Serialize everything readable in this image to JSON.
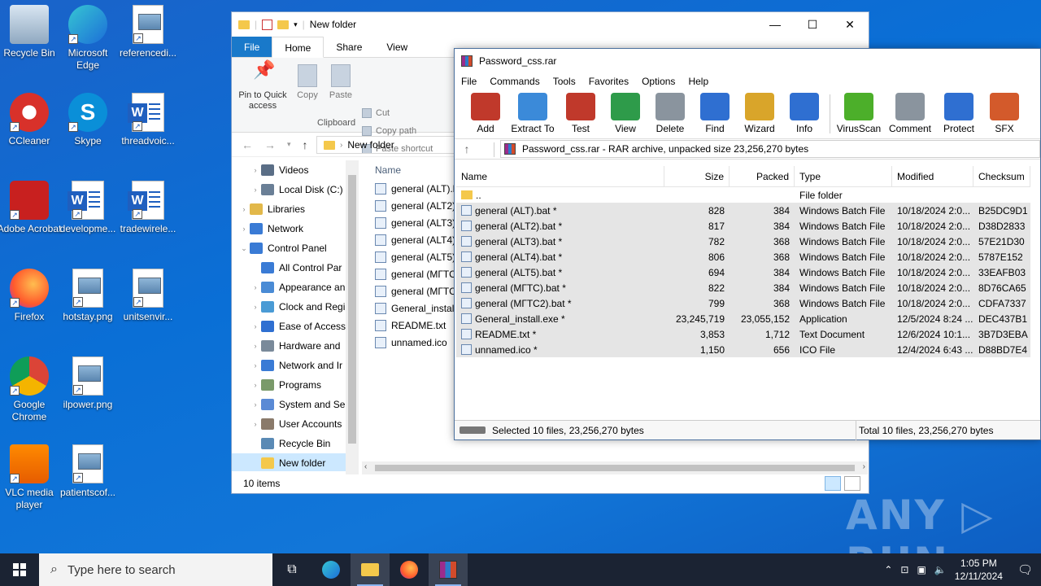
{
  "desktop": {
    "icons": [
      {
        "label": "Recycle Bin"
      },
      {
        "label": "Microsoft Edge"
      },
      {
        "label": "referencedi..."
      },
      {
        "label": "CCleaner"
      },
      {
        "label": "Skype"
      },
      {
        "label": "threadvoic..."
      },
      {
        "label": "Adobe Acrobat"
      },
      {
        "label": "developme..."
      },
      {
        "label": "tradewirele..."
      },
      {
        "label": "Firefox"
      },
      {
        "label": "hotstay.png"
      },
      {
        "label": "unitsenvir..."
      },
      {
        "label": "Google Chrome"
      },
      {
        "label": "ilpower.png"
      },
      {
        "label": "VLC media player"
      },
      {
        "label": "patientscof..."
      }
    ]
  },
  "explorer": {
    "title": "New folder",
    "tabs": {
      "file": "File",
      "home": "Home",
      "share": "Share",
      "view": "View"
    },
    "ribbon": {
      "pin": "Pin to Quick access",
      "copy": "Copy",
      "paste": "Paste",
      "cut": "Cut",
      "copy_path": "Copy path",
      "paste_shortcut": "Paste shortcut",
      "group": "Clipboard"
    },
    "address": "New folder",
    "nav": [
      {
        "label": "Videos"
      },
      {
        "label": "Local Disk (C:)"
      },
      {
        "label": "Libraries"
      },
      {
        "label": "Network"
      },
      {
        "label": "Control Panel"
      },
      {
        "label": "All Control Par"
      },
      {
        "label": "Appearance an"
      },
      {
        "label": "Clock and Regi"
      },
      {
        "label": "Ease of Access"
      },
      {
        "label": "Hardware and"
      },
      {
        "label": "Network and Ir"
      },
      {
        "label": "Programs"
      },
      {
        "label": "System and Se"
      },
      {
        "label": "User Accounts"
      },
      {
        "label": "Recycle Bin"
      },
      {
        "label": "New folder"
      }
    ],
    "column_name": "Name",
    "files": [
      {
        "label": "general (ALT).b"
      },
      {
        "label": "general (ALT2)"
      },
      {
        "label": "general (ALT3)"
      },
      {
        "label": "general (ALT4)"
      },
      {
        "label": "general (ALT5)"
      },
      {
        "label": "general (МГТС"
      },
      {
        "label": "general (МГТС"
      },
      {
        "label": "General_install"
      },
      {
        "label": "README.txt"
      },
      {
        "label": "unnamed.ico"
      }
    ],
    "status": "10 items"
  },
  "winrar": {
    "title": "Password_css.rar",
    "menu": [
      "File",
      "Commands",
      "Tools",
      "Favorites",
      "Options",
      "Help"
    ],
    "toolbar": [
      {
        "label": "Add",
        "color": "#c0392b"
      },
      {
        "label": "Extract To",
        "color": "#3b8ad9"
      },
      {
        "label": "Test",
        "color": "#c0392b"
      },
      {
        "label": "View",
        "color": "#2e9b4a"
      },
      {
        "label": "Delete",
        "color": "#8a949e"
      },
      {
        "label": "Find",
        "color": "#2f6fd1"
      },
      {
        "label": "Wizard",
        "color": "#d9a52a"
      },
      {
        "label": "Info",
        "color": "#2f6fd1"
      },
      {
        "label": "VirusScan",
        "color": "#4caf2a"
      },
      {
        "label": "Comment",
        "color": "#8a949e"
      },
      {
        "label": "Protect",
        "color": "#2f6fd1"
      },
      {
        "label": "SFX",
        "color": "#d35a2b"
      }
    ],
    "path": "Password_css.rar - RAR archive, unpacked size 23,256,270 bytes",
    "columns": {
      "name": "Name",
      "size": "Size",
      "packed": "Packed",
      "type": "Type",
      "modified": "Modified",
      "checksum": "Checksum"
    },
    "rows": [
      {
        "name": "..",
        "size": "",
        "packed": "",
        "type": "File folder",
        "modified": "",
        "checksum": ""
      },
      {
        "name": "general (ALT).bat *",
        "size": "828",
        "packed": "384",
        "type": "Windows Batch File",
        "modified": "10/18/2024 2:0...",
        "checksum": "B25DC9D1"
      },
      {
        "name": "general (ALT2).bat *",
        "size": "817",
        "packed": "384",
        "type": "Windows Batch File",
        "modified": "10/18/2024 2:0...",
        "checksum": "D38D2833"
      },
      {
        "name": "general (ALT3).bat *",
        "size": "782",
        "packed": "368",
        "type": "Windows Batch File",
        "modified": "10/18/2024 2:0...",
        "checksum": "57E21D30"
      },
      {
        "name": "general (ALT4).bat *",
        "size": "806",
        "packed": "368",
        "type": "Windows Batch File",
        "modified": "10/18/2024 2:0...",
        "checksum": "5787E152"
      },
      {
        "name": "general (ALT5).bat *",
        "size": "694",
        "packed": "384",
        "type": "Windows Batch File",
        "modified": "10/18/2024 2:0...",
        "checksum": "33EAFB03"
      },
      {
        "name": "general (МГТС).bat *",
        "size": "822",
        "packed": "384",
        "type": "Windows Batch File",
        "modified": "10/18/2024 2:0...",
        "checksum": "8D76CA65"
      },
      {
        "name": "general (МГТС2).bat *",
        "size": "799",
        "packed": "368",
        "type": "Windows Batch File",
        "modified": "10/18/2024 2:0...",
        "checksum": "CDFA7337"
      },
      {
        "name": "General_install.exe *",
        "size": "23,245,719",
        "packed": "23,055,152",
        "type": "Application",
        "modified": "12/5/2024 8:24 ...",
        "checksum": "DEC437B1"
      },
      {
        "name": "README.txt *",
        "size": "3,853",
        "packed": "1,712",
        "type": "Text Document",
        "modified": "12/6/2024 10:1...",
        "checksum": "3B7D3EBA"
      },
      {
        "name": "unnamed.ico *",
        "size": "1,150",
        "packed": "656",
        "type": "ICO File",
        "modified": "12/4/2024 6:43 ...",
        "checksum": "D88BD7E4"
      }
    ],
    "status_left": "Selected 10 files, 23,256,270 bytes",
    "status_right": "Total 10 files, 23,256,270 bytes"
  },
  "watermark": "ANY ▷ RUN",
  "taskbar": {
    "search_placeholder": "Type here to search",
    "time": "1:05 PM",
    "date": "12/11/2024"
  }
}
